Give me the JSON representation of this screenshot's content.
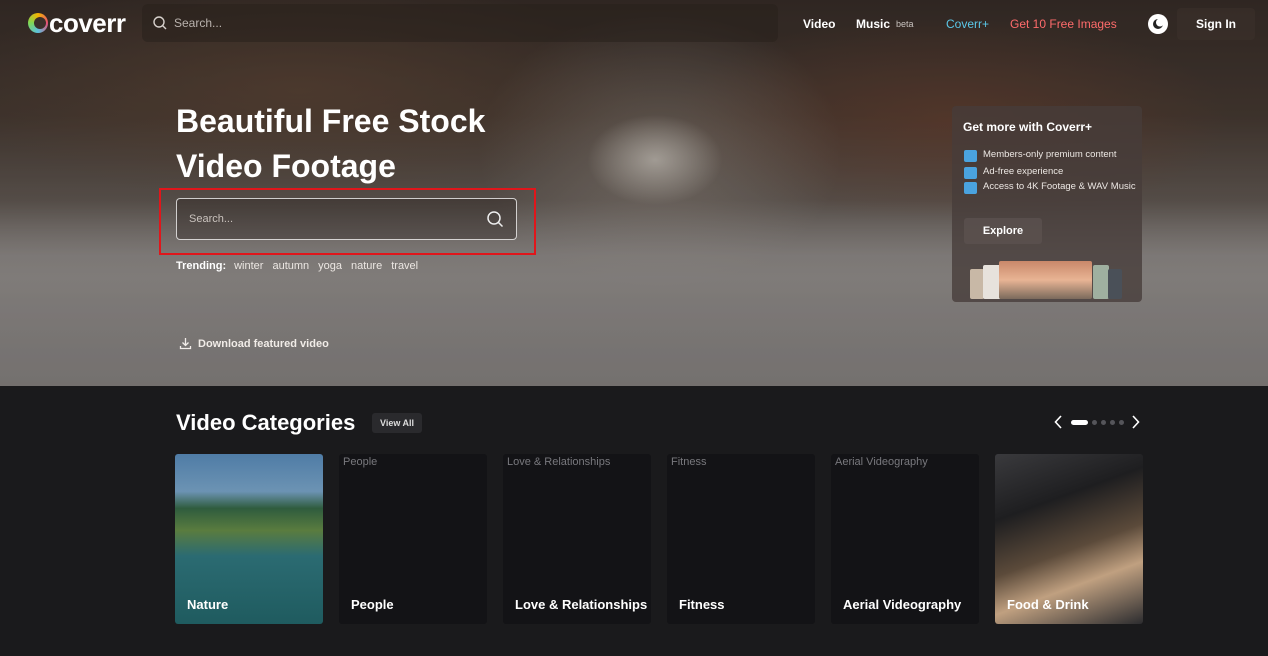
{
  "brand": {
    "logo_text": "coverr"
  },
  "nav": {
    "search_placeholder": "Search...",
    "links": {
      "video": "Video",
      "music": "Music",
      "beta": "beta",
      "coverr_plus": "Coverr+",
      "free_images": "Get 10 Free Images"
    },
    "sign_in": "Sign In",
    "colors": {
      "coverr_plus": "#5bc8e8",
      "free_images": "#ff6b6b"
    }
  },
  "hero": {
    "headline_line1": "Beautiful Free Stock",
    "headline_line2": "Video Footage",
    "search_placeholder": "Search...",
    "trending_label": "Trending:",
    "trending": [
      "winter",
      "autumn",
      "yoga",
      "nature",
      "travel"
    ],
    "download_label": "Download featured video"
  },
  "promo": {
    "title": "Get more with Coverr+",
    "items": [
      "Members-only premium content",
      "Ad-free experience",
      "Access to 4K Footage & WAV Music"
    ],
    "explore": "Explore"
  },
  "categories": {
    "title": "Video Categories",
    "view_all": "View All",
    "items": [
      {
        "label": "Nature",
        "alt": ""
      },
      {
        "label": "People",
        "alt": "People"
      },
      {
        "label": "Love & Relationships",
        "alt": "Love & Relationships"
      },
      {
        "label": "Fitness",
        "alt": "Fitness"
      },
      {
        "label": "Aerial Videography",
        "alt": "Aerial Videography"
      },
      {
        "label": "Food & Drink",
        "alt": ""
      }
    ]
  }
}
